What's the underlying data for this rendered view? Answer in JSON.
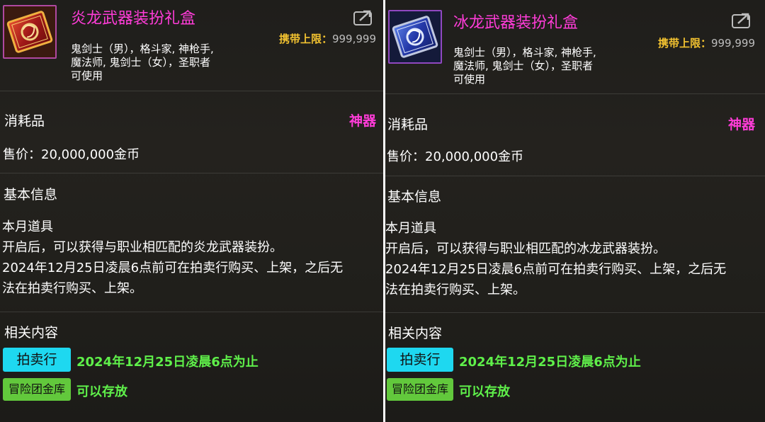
{
  "panels": [
    {
      "icon": "dragon-flame-giftbox-icon",
      "title": "炎龙武器装扮礼盒",
      "limit_label": "携带上限：",
      "limit_value": "999,999",
      "usable_lines": [
        "鬼剑士（男），格斗家, 神枪手,",
        "魔法师, 鬼剑士（女），圣职者",
        "可使用"
      ],
      "category": "消耗品",
      "rarity": "神器",
      "price": "售价：20,000,000金币",
      "basic_heading": "基本信息",
      "desc_lines": [
        "本月道具",
        "开启后，可以获得与职业相匹配的炎龙武器装扮。",
        "2024年12月25日凌晨6点前可在拍卖行购买、上架，之后无",
        "法在拍卖行购买、上架。"
      ],
      "related_heading": "相关内容",
      "auction_label": "拍卖行",
      "auction_text": "2024年12月25日凌晨6点为止",
      "storage_label": "冒险团金库",
      "storage_text": "可以存放"
    },
    {
      "icon": "ice-dragon-giftbox-icon",
      "title": "冰龙武器装扮礼盒",
      "limit_label": "携带上限：",
      "limit_value": "999,999",
      "usable_lines": [
        "鬼剑士（男），格斗家, 神枪手,",
        "魔法师, 鬼剑士（女），圣职者",
        "可使用"
      ],
      "category": "消耗品",
      "rarity": "神器",
      "price": "售价：20,000,000金币",
      "basic_heading": "基本信息",
      "desc_lines": [
        "本月道具",
        "开启后，可以获得与职业相匹配的冰龙武器装扮。",
        "2024年12月25日凌晨6点前可在拍卖行购买、上架，之后无",
        "法在拍卖行购买、上架。"
      ],
      "related_heading": "相关内容",
      "auction_label": "拍卖行",
      "auction_text": "2024年12月25日凌晨6点为止",
      "storage_label": "冒险团金库",
      "storage_text": "可以存放"
    }
  ],
  "colors": {
    "title": "#ff3cd8",
    "rarity": "#ff3cd8",
    "limit_label": "#f2c230",
    "auction_tag": "#1ed8f0",
    "storage_tag": "#62c83c",
    "green_text": "#5ff04a"
  }
}
